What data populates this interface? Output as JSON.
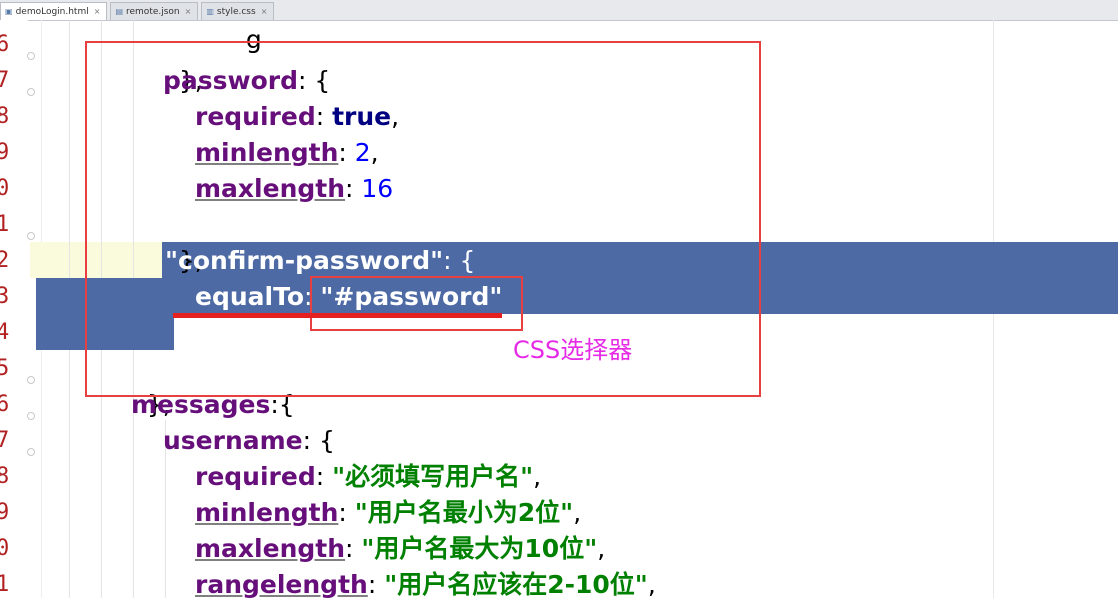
{
  "tabs": [
    {
      "label": "demoLogin.html",
      "icon": "html-file-icon",
      "close": "×"
    },
    {
      "label": "remote.json",
      "icon": "json-file-icon",
      "close": "×"
    },
    {
      "label": "style.css",
      "icon": "css-file-icon",
      "close": "×"
    }
  ],
  "line_numbers": [
    "6",
    "7",
    "8",
    "9",
    "0",
    "1",
    "2",
    "3",
    "4",
    "5",
    "6",
    "7",
    "8",
    "9",
    "0",
    "1"
  ],
  "code": {
    "top_partial": "g",
    "l0_close": "},",
    "password_key": "password",
    "password_open": ": {",
    "required_key": "required",
    "colon_sp": ": ",
    "true_val": "true",
    "comma": ",",
    "minlength_key": "minlength",
    "minlength_val": "2",
    "maxlength_key": "maxlength",
    "maxlength_val": "16",
    "l5_close": "},",
    "confirm_key": "\"confirm-password\"",
    "confirm_open": ": {",
    "equalto_key": "equalTo",
    "equalto_colon": ":",
    "equalto_val": "\"#password\"",
    "l8_close": "}",
    "l9_close": "},",
    "messages_key": "messages",
    "messages_open": ":{",
    "username_key": "username",
    "username_open": ": {",
    "msg_required": "\"必须填写用户名\"",
    "msg_minlength": "\"用户名最小为2位\"",
    "msg_maxlength": "\"用户名最大为10位\"",
    "rangelength_key": "rangelength",
    "msg_rangelength": "\"用户名应该在2-10位\""
  },
  "annotation": {
    "label": "CSS选择器",
    "box_color": "#e84040",
    "label_color": "#e62be6"
  },
  "colors": {
    "selection": "#4d6aa5",
    "key": "#660e7a",
    "keyword": "#000080",
    "number": "#0000ff",
    "string": "#008000",
    "line_number": "#b22222"
  }
}
